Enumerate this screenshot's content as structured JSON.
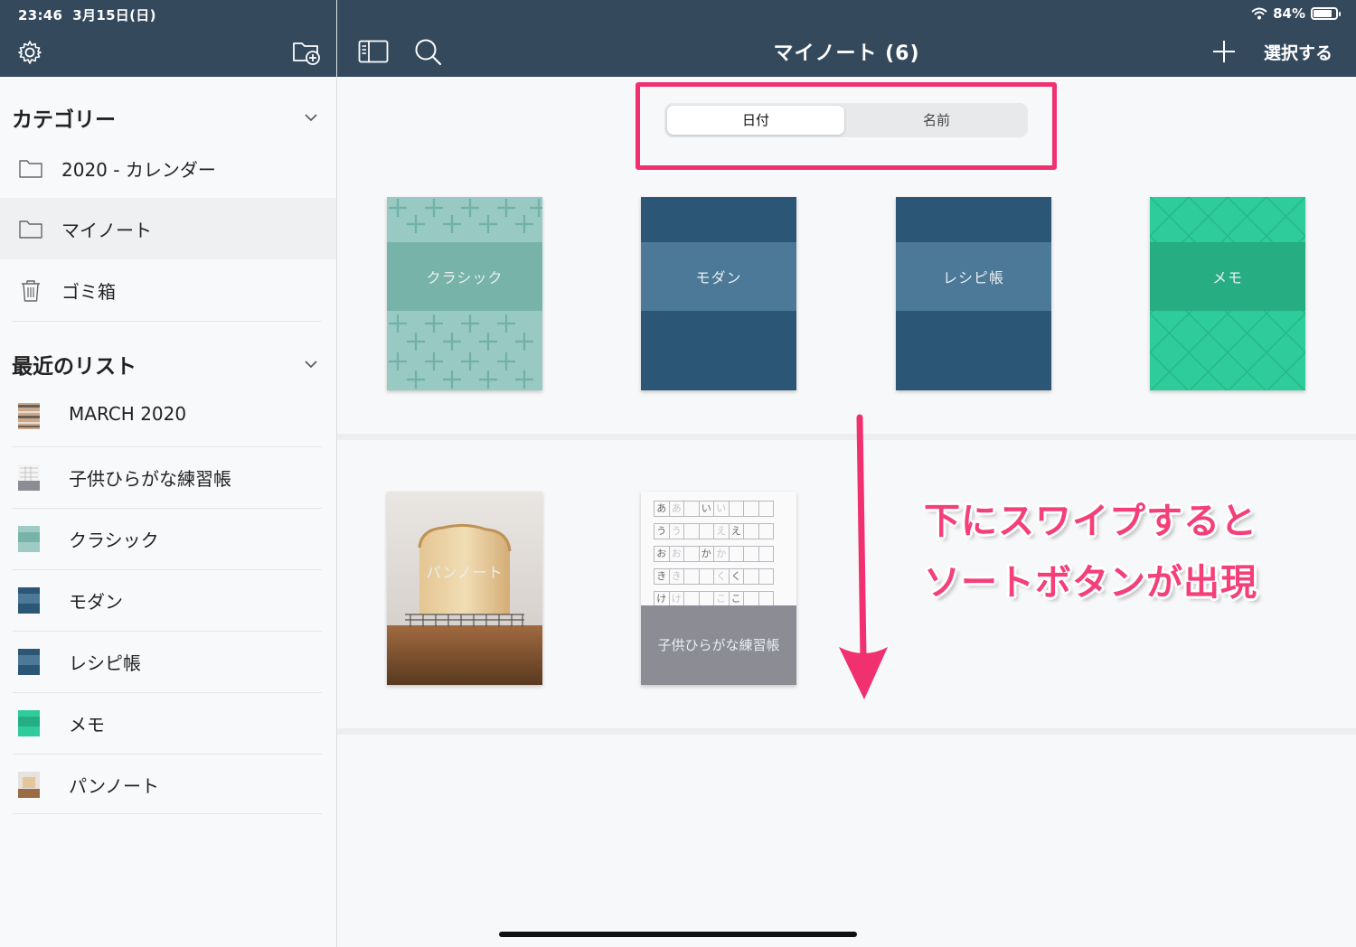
{
  "status": {
    "time": "23:46",
    "date": "3月15日(日)",
    "battery": "84%",
    "battery_level": 0.84
  },
  "header": {
    "title": "マイノート (6)",
    "select_label": "選択する"
  },
  "icons": {
    "settings": "gear-icon",
    "new_folder": "folder-plus-icon",
    "sidebar_toggle": "sidebar-icon",
    "search": "search-icon",
    "add": "plus-icon",
    "wifi": "wifi-icon",
    "battery": "battery-icon"
  },
  "sidebar": {
    "categories_title": "カテゴリー",
    "categories": [
      {
        "label": "2020 - カレンダー",
        "icon": "folder-icon",
        "selected": false
      },
      {
        "label": "マイノート",
        "icon": "folder-icon",
        "selected": true
      },
      {
        "label": "ゴミ箱",
        "icon": "trash-icon",
        "selected": false
      }
    ],
    "recent_title": "最近のリスト",
    "recent": [
      {
        "label": "MARCH 2020"
      },
      {
        "label": "子供ひらがな練習帳"
      },
      {
        "label": "クラシック"
      },
      {
        "label": "モダン"
      },
      {
        "label": "レシピ帳"
      },
      {
        "label": "メモ"
      },
      {
        "label": "パンノート"
      }
    ]
  },
  "sort": {
    "options": [
      "日付",
      "名前"
    ],
    "selected": "日付"
  },
  "notebooks": [
    {
      "label": "クラシック"
    },
    {
      "label": "モダン"
    },
    {
      "label": "レシピ帳"
    },
    {
      "label": "メモ"
    },
    {
      "label": "パンノート"
    },
    {
      "label": "子供ひらがな練習帳"
    }
  ],
  "worksheet": {
    "rows": [
      [
        "あ",
        "あ",
        "",
        "い",
        "い",
        "",
        "",
        ""
      ],
      [
        "う",
        "う",
        "",
        "",
        "え",
        "え",
        "",
        ""
      ],
      [
        "お",
        "お",
        "",
        "か",
        "か",
        "",
        "",
        ""
      ],
      [
        "き",
        "き",
        "",
        "",
        "く",
        "く",
        "",
        ""
      ],
      [
        "け",
        "け",
        "",
        "",
        "こ",
        "こ",
        "",
        ""
      ]
    ]
  },
  "annotation": {
    "line1": "下にスワイプすると",
    "line2": "ソートボタンが出現"
  },
  "colors": {
    "header_bg": "#34495c",
    "accent": "#f0306f",
    "classic": "#8fc4bc",
    "modern": "#2b5676",
    "memo": "#2ecc9a",
    "kids": "#8b8c94"
  }
}
